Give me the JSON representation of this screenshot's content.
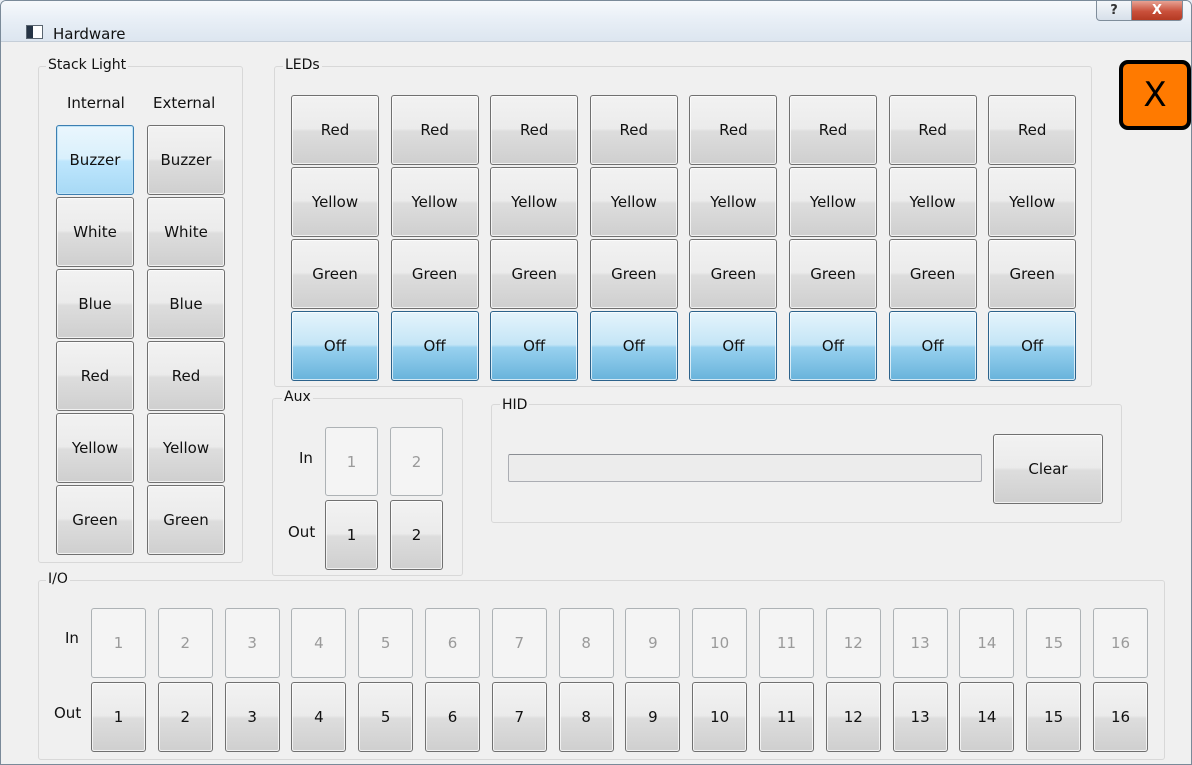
{
  "window": {
    "title": "Hardware",
    "help_label": "?",
    "close_label": "X"
  },
  "corner_button": {
    "label": "X",
    "color": "#ff7a00"
  },
  "stack_light": {
    "title": "Stack Light",
    "internal_header": "Internal",
    "external_header": "External",
    "rows": [
      {
        "internal": "Buzzer",
        "external": "Buzzer"
      },
      {
        "internal": "White",
        "external": "White"
      },
      {
        "internal": "Blue",
        "external": "Blue"
      },
      {
        "internal": "Red",
        "external": "Red"
      },
      {
        "internal": "Yellow",
        "external": "Yellow"
      },
      {
        "internal": "Green",
        "external": "Green"
      }
    ]
  },
  "leds": {
    "title": "LEDs",
    "columns": [
      {
        "red": "Red",
        "yellow": "Yellow",
        "green": "Green",
        "off": "Off"
      },
      {
        "red": "Red",
        "yellow": "Yellow",
        "green": "Green",
        "off": "Off"
      },
      {
        "red": "Red",
        "yellow": "Yellow",
        "green": "Green",
        "off": "Off"
      },
      {
        "red": "Red",
        "yellow": "Yellow",
        "green": "Green",
        "off": "Off"
      },
      {
        "red": "Red",
        "yellow": "Yellow",
        "green": "Green",
        "off": "Off"
      },
      {
        "red": "Red",
        "yellow": "Yellow",
        "green": "Green",
        "off": "Off"
      },
      {
        "red": "Red",
        "yellow": "Yellow",
        "green": "Green",
        "off": "Off"
      },
      {
        "red": "Red",
        "yellow": "Yellow",
        "green": "Green",
        "off": "Off"
      }
    ]
  },
  "aux": {
    "title": "Aux",
    "in_label": "In",
    "out_label": "Out",
    "in_buttons": [
      "1",
      "2"
    ],
    "out_buttons": [
      "1",
      "2"
    ]
  },
  "hid": {
    "title": "HID",
    "input_value": "",
    "clear_label": "Clear"
  },
  "io": {
    "title": "I/O",
    "in_label": "In",
    "out_label": "Out",
    "in_buttons": [
      "1",
      "2",
      "3",
      "4",
      "5",
      "6",
      "7",
      "8",
      "9",
      "10",
      "11",
      "12",
      "13",
      "14",
      "15",
      "16"
    ],
    "out_buttons": [
      "1",
      "2",
      "3",
      "4",
      "5",
      "6",
      "7",
      "8",
      "9",
      "10",
      "11",
      "12",
      "13",
      "14",
      "15",
      "16"
    ]
  }
}
